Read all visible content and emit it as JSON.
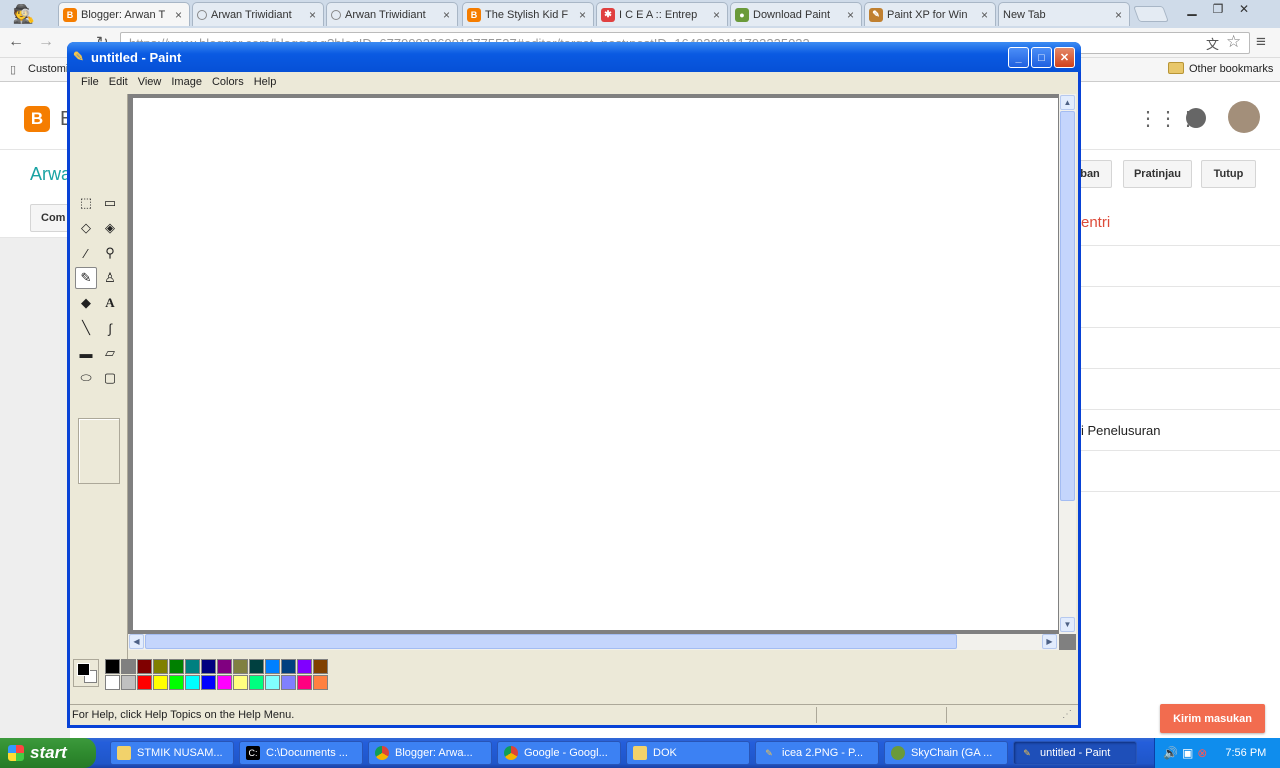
{
  "browser": {
    "tabs": [
      {
        "label": "Blogger: Arwan T",
        "icon": "blogger-icon",
        "color": "#f57d00"
      },
      {
        "label": "Arwan Triwidiant",
        "icon": "loading-icon",
        "color": "#999999"
      },
      {
        "label": "Arwan Triwidiant",
        "icon": "loading-icon",
        "color": "#999999"
      },
      {
        "label": "The Stylish Kid F",
        "icon": "blogger-icon",
        "color": "#f57d00"
      },
      {
        "label": "I C E A :: Entrep",
        "icon": "icea-icon",
        "color": "#e04040"
      },
      {
        "label": "Download Paint",
        "icon": "globe-icon",
        "color": "#6a9a3a"
      },
      {
        "label": "Paint XP for Win",
        "icon": "paint-icon",
        "color": "#c08030"
      },
      {
        "label": "New Tab",
        "icon": "",
        "color": ""
      }
    ],
    "url": "https://www.blogger.com/blogger.g?blogID=6779993269913775537#editor/target=post;postID=1649309111793225033",
    "bookmark_left": "Customiz",
    "bookmark_right": "Other bookmarks"
  },
  "blogger": {
    "logo_letter": "B",
    "logo_text": "B",
    "blog_name": "Arwa",
    "compose_label": "Com",
    "publish_label": "ban",
    "preview_label": "Pratinjau",
    "close_label": "Tutup",
    "side_label_1": "entri",
    "side_label_2": "i Penelusuran",
    "send_feedback": "Kirim masukan"
  },
  "paint": {
    "title": "untitled - Paint",
    "menu": [
      "File",
      "Edit",
      "View",
      "Image",
      "Colors",
      "Help"
    ],
    "status": "For Help, click Help Topics on the Help Menu.",
    "palette_top": [
      "#000000",
      "#808080",
      "#800000",
      "#808000",
      "#008000",
      "#008080",
      "#000080",
      "#800080",
      "#808040",
      "#004040",
      "#0080ff",
      "#004080",
      "#8000ff",
      "#804000"
    ],
    "palette_bottom": [
      "#ffffff",
      "#c0c0c0",
      "#ff0000",
      "#ffff00",
      "#00ff00",
      "#00ffff",
      "#0000ff",
      "#ff00ff",
      "#ffff80",
      "#00ff80",
      "#80ffff",
      "#8080ff",
      "#ff0080",
      "#ff8040"
    ]
  },
  "taskbar": {
    "start": "start",
    "tasks": [
      {
        "label": "STMIK NUSAM...",
        "icon": "folder-icon"
      },
      {
        "label": "C:\\Documents ...",
        "icon": "cmd-icon"
      },
      {
        "label": "Blogger: Arwa...",
        "icon": "chrome-icon"
      },
      {
        "label": "Google - Googl...",
        "icon": "chrome-icon"
      },
      {
        "label": "DOK",
        "icon": "folder-icon"
      },
      {
        "label": "icea 2.PNG - P...",
        "icon": "paint-icon"
      },
      {
        "label": "SkyChain (GA ...",
        "icon": "globe-icon"
      },
      {
        "label": "untitled - Paint",
        "icon": "paint-icon"
      }
    ],
    "clock": "7:56 PM"
  }
}
